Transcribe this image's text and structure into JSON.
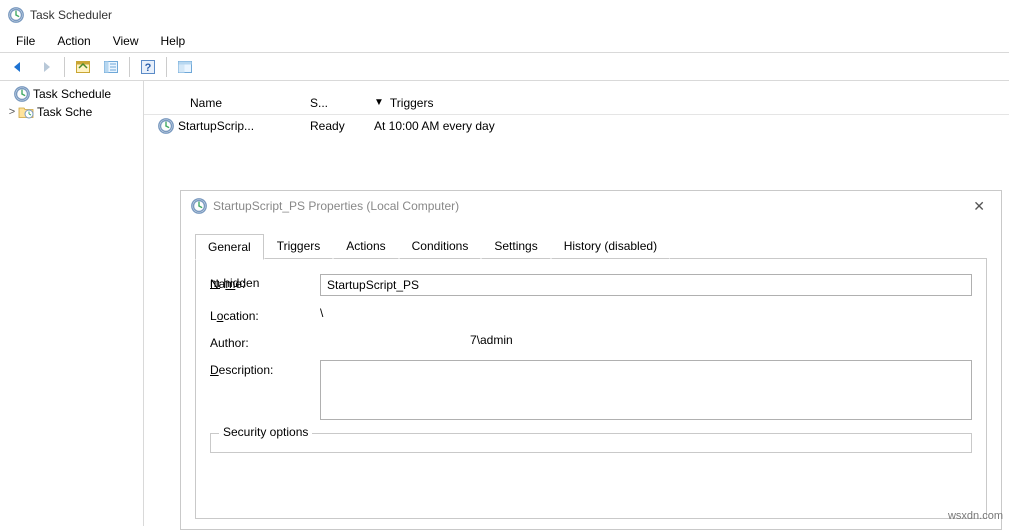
{
  "window": {
    "title": "Task Scheduler"
  },
  "menu": {
    "file": "File",
    "action": "Action",
    "view": "View",
    "help": "Help"
  },
  "tree": {
    "root": "Task Schedule",
    "child": "Task Sche"
  },
  "list": {
    "cols": {
      "name": "Name",
      "status": "S...",
      "triggers": "Triggers"
    },
    "row": {
      "name": "StartupScrip...",
      "status": "Ready",
      "triggers": "At 10:00 AM every day"
    }
  },
  "dialog": {
    "title": "StartupScript_PS Properties (Local Computer)",
    "tabs": {
      "general": "General",
      "triggers": "Triggers",
      "actions": "Actions",
      "conditions": "Conditions",
      "settings": "Settings",
      "history": "History (disabled)"
    },
    "labels": {
      "name": "Name:",
      "location": "Location:",
      "author": "Author:",
      "description": "Description:",
      "security": "Security options"
    },
    "values": {
      "name": "StartupScript_PS",
      "location": "\\",
      "author": "7\\admin",
      "description": ""
    }
  },
  "watermark": "wsxdn.com"
}
